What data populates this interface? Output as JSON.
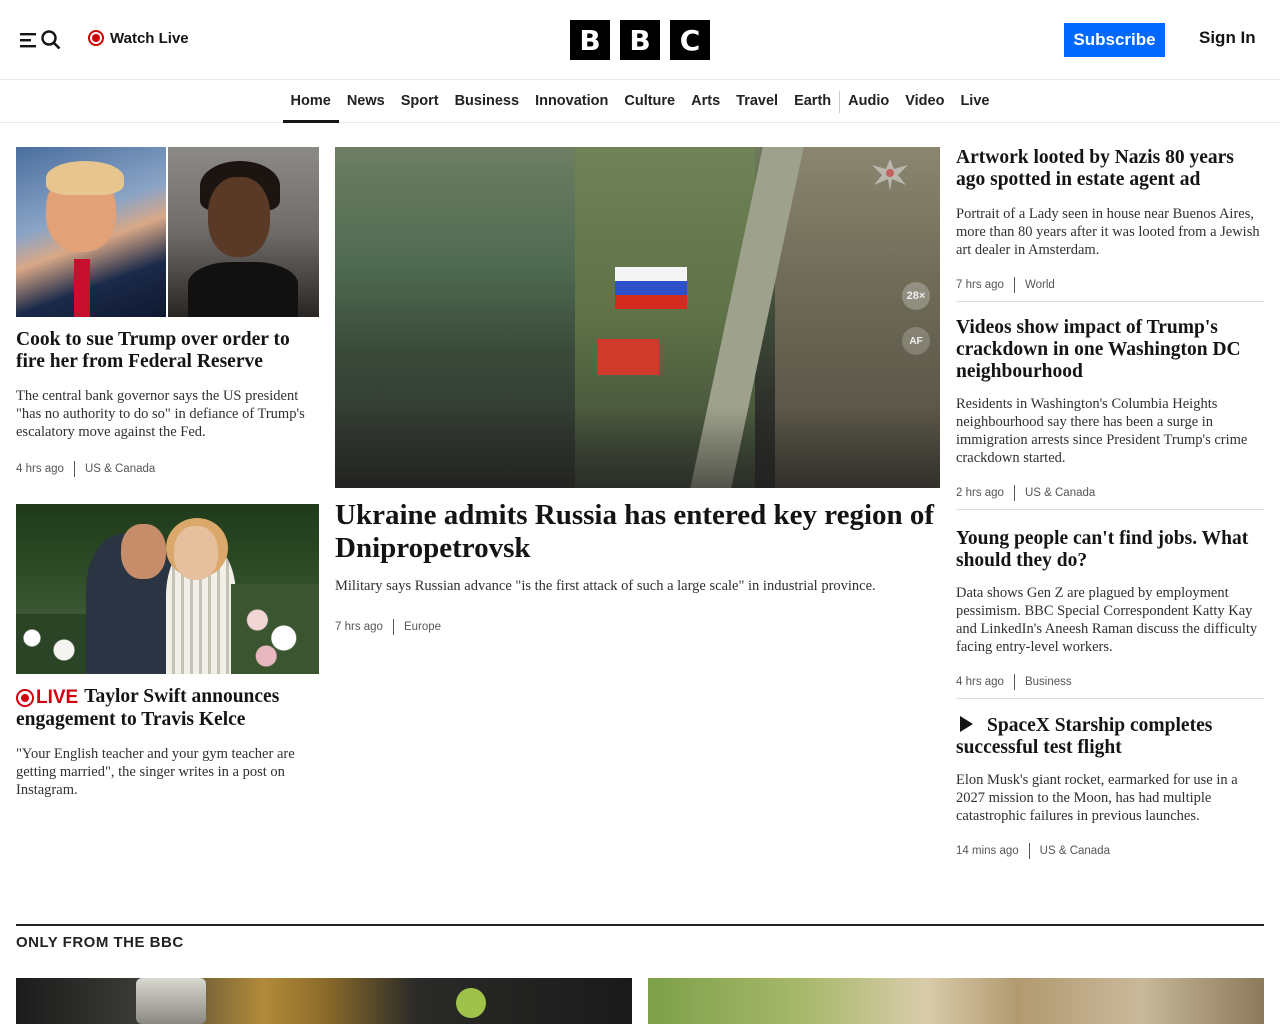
{
  "header": {
    "watch_live": "Watch Live",
    "logo": [
      "B",
      "B",
      "C"
    ],
    "subscribe": "Subscribe",
    "sign_in": "Sign In"
  },
  "nav": {
    "items": [
      "Home",
      "News",
      "Sport",
      "Business",
      "Innovation",
      "Culture",
      "Arts",
      "Travel",
      "Earth",
      "Audio",
      "Video",
      "Live"
    ],
    "active": "Home"
  },
  "left": {
    "story1": {
      "headline": "Cook to sue Trump over order to fire her from Federal Reserve",
      "summary": "The central bank governor says the US president \"has no authority to do so\" in defiance of Trump's escalatory move against the Fed.",
      "time": "4 hrs ago",
      "section": "US & Canada"
    },
    "story2": {
      "live_label": "LIVE",
      "headline": "Taylor Swift announces engagement to Travis Kelce",
      "summary": "\"Your English teacher and your gym teacher are getting married\", the singer writes in a post on Instagram."
    }
  },
  "center": {
    "image_overlay": {
      "zoom": "28×",
      "mode": "AF"
    },
    "headline": "Ukraine admits Russia has entered key region of Dnipropetrovsk",
    "summary": "Military says Russian advance \"is the first attack of such a large scale\" in industrial province.",
    "time": "7 hrs ago",
    "section": "Europe"
  },
  "right": {
    "story1": {
      "headline": "Artwork looted by Nazis 80 years ago spotted in estate agent ad",
      "summary": "Portrait of a Lady seen in house near Buenos Aires, more than 80 years after it was looted from a Jewish art dealer in Amsterdam.",
      "time": "7 hrs ago",
      "section": "World"
    },
    "story2": {
      "headline": "Videos show impact of Trump's crackdown in one Washington DC neighbourhood",
      "summary": "Residents in Washington's Columbia Heights neighbourhood say there has been a surge in immigration arrests since President Trump's crime crackdown started.",
      "time": "2 hrs ago",
      "section": "US & Canada"
    },
    "story3": {
      "headline": "Young people can't find jobs. What should they do?",
      "summary": "Data shows Gen Z are plagued by employment pessimism. BBC Special Correspondent Katty Kay and LinkedIn's Aneesh Raman discuss the difficulty facing entry-level workers.",
      "time": "4 hrs ago",
      "section": "Business"
    },
    "story4": {
      "headline": "SpaceX Starship completes successful test flight",
      "summary": "Elon Musk's giant rocket, earmarked for use in a 2027 mission to the Moon, has had multiple catastrophic failures in previous launches.",
      "time": "14 mins ago",
      "section": "US & Canada"
    }
  },
  "only_from_bbc": {
    "title": "ONLY FROM THE BBC"
  },
  "colors": {
    "subscribe_blue": "#0068ff",
    "live_red": "#d2000f"
  }
}
